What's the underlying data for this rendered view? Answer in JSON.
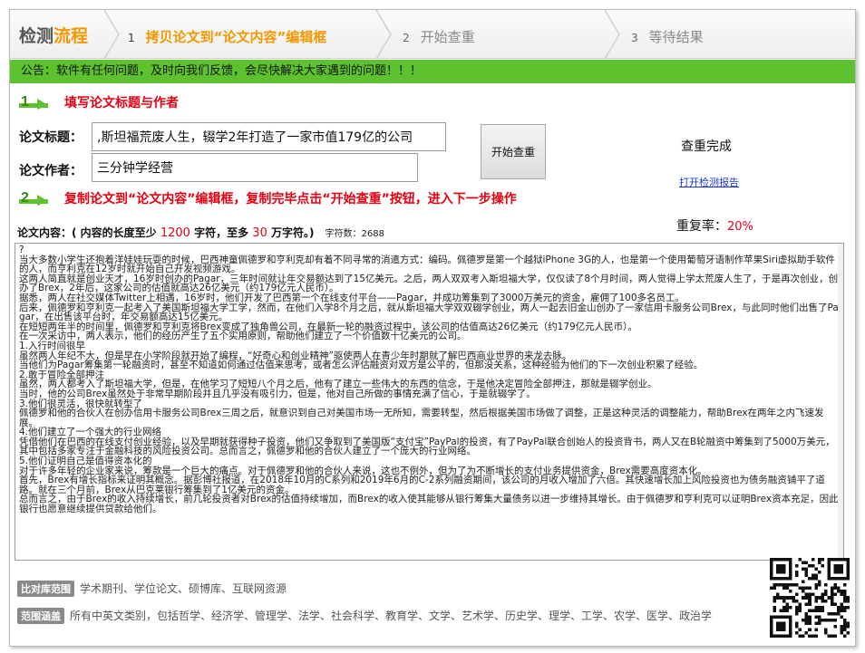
{
  "header": {
    "brand_prefix": "检测",
    "brand_accent": "流程",
    "steps": [
      {
        "num": "1",
        "label": "拷贝论文到“论文内容”编辑框"
      },
      {
        "num": "2",
        "label": "开始查重"
      },
      {
        "num": "3",
        "label": "等待结果"
      }
    ]
  },
  "notice": "公告：软件有任何问题，及时向我们反馈，会尽快解决大家遇到的问题！！！",
  "section1": {
    "title": "填写论文标题与作者",
    "title_label": "论文标题：",
    "title_value": ",斯坦福荒废人生，辍学2年打造了一家市值179亿的公司",
    "author_label": "论文作者：",
    "author_value": "三分钟学经营"
  },
  "check_button": "开始查重",
  "result": {
    "status": "查重完成",
    "report_link": "打开检测报告",
    "repeat_label": "重复率：",
    "repeat_value": "20%"
  },
  "section2": {
    "title": "复制论文到“论文内容”编辑框，复制完毕点击“开始查重”按钮，进入下一步操作"
  },
  "content_label": {
    "prefix": "论文内容：( 内容的长度至少 ",
    "min": "1200",
    "mid": " 字符，至多 ",
    "max": "30",
    "suffix": " 万字符。)",
    "count_label": "字符数：",
    "count_value": "2688"
  },
  "content_text": "?\n当大多数小学生还抱着洋娃娃玩耍的时候，巴西神童佩德罗和亨利克却有着不同寻常的消遣方式：编码。佩德罗是第一个越狱iPhone 3G的人，也是第一个使用葡萄牙语制作苹果Siri虚拟助手软件的人，而亨利克在12岁时就开始自己开发视频游戏。\n这两人简直就是创业天才，16岁时创办的Pagar，三年时间就让年交易额达到了15亿美元。之后，两人双双考入斯坦福大学，仅仅读了8个月时间，两人觉得上学太荒废人生了，于是再次创业，创办了Brex，2年后，这家公司的估值就高达26亿美元（约179亿元人民币）。\n据悉，两人在社交媒体Twitter上相遇，16岁时，他们开发了巴西第一个在线支付平台——Pagar，并成功筹集到了3000万美元的资金，雇佣了100多名员工。\n后来，佩德罗和亨利克一起考入了美国斯坦福大学工学，然而，在他们入学8个月之后，就从斯坦福大学双双辍学创业，两人一起去旧金山创办了一家信用卡服务公司Brex，与此同时他们出售了Pagar，在出售该平台时，年交易额高达15亿美元。\n在短短两年半的时间里，佩德罗和亨利克将Brex变成了独角兽公司，在最新一轮的融资过程中，该公司的估值高达26亿美元（约179亿元人民币）。\n在一次采访中，两人表示，他们的经历产生了五个实用原则，帮助他们建立了一个价值数十亿美元的公司。\n1.入行时间很早\n虽然两人年纪不大，但是早在小学阶段就开始了编程，“好奇心和创业精神”驱使两人在青少年时期就了解巴西商业世界的来龙去脉。\n当他们为Pagar筹集第一轮融资时，甚至不知道如何通过估值来思考，或者怎么评估融资对双方是公平的，但那没关系，这种经验为他们的下一次创业积累了经验。\n2.敢于冒险全部押注\n虽然，两人都考入了斯坦福大学，但是，在他学习了短短八个月之后，他有了建立一些伟大的东西的信念，于是他决定冒险全部押注，那就是辍学创业。\n当时，他的公司Brex虽然处于非常早期阶段并且几乎没有吸引力，但是，他对自己所做的事情充满了信心，于是就辍学了。\n3.他们很灵活，很快就转型了\n佩德罗和他的合伙人在创办信用卡服务公司Brex三周之后，就意识到自己对美国市场一无所知，需要转型，然后根据美国市场做了调整，正是这种灵活的调整能力，帮助Brex在两年之内飞速发展。\n4.他们建立了一个强大的行业网络\n凭借他们在巴西的在线支付创业经验，以及早期就获得种子投资，他们又争取到了美国版“支付宝”PayPal的投资，有了PayPal联合创始人的投资背书，两人又在B轮融资中筹集到了5000万美元，其中包括多家专注于金融科技的风险投资公司。总而言之，佩德罗和他的合伙人建立了一个庞大的行业网络。\n5.他们证明自己是值得资本化的\n对于许多年轻的企业家来说，筹款是一个巨大的痛点。对于佩德罗和他的合伙人来说，这也不例外，但为了为不断增长的支付业务提供资金，Brex需要高度资本化。\n首先，Brex有增长指标来证明其概念。据彭博社报道，在2018年10月的C系列和2019年6月的C-2系列融资期间，该公司的月收入增加了六倍。其快速增长加上风险投资也为债务融资铺平了道路。就在三个月前，Brex从巴克莱银行筹集到了1亿美元的资金。\n总而言之，由于Brex的收入持续增长，前几轮投资者对Brex的估值持续增加，而Brex的收入使其能够从银行筹集大量债务以进一步维持其增长。由于佩德罗和亨利克可以证明Brex资本充足，因此银行也愿意继续提供贷款给他们。",
  "footer": {
    "row1_tag": "比对库范围",
    "row1_text": "学术期刊、学位论文、硕博库、互联网资源",
    "row2_tag": "范围涵盖",
    "row2_text": "所有中英文类别，包括哲学、经济学、管理学、法学、社会科学、教育学、文学、艺术学、历史学、理学、工学、农学、医学、政治学"
  },
  "colors": {
    "accent_orange": "#f39800",
    "notice_green": "#5ec22f",
    "alert_red": "#e60012",
    "link_blue": "#1a3bd6"
  }
}
